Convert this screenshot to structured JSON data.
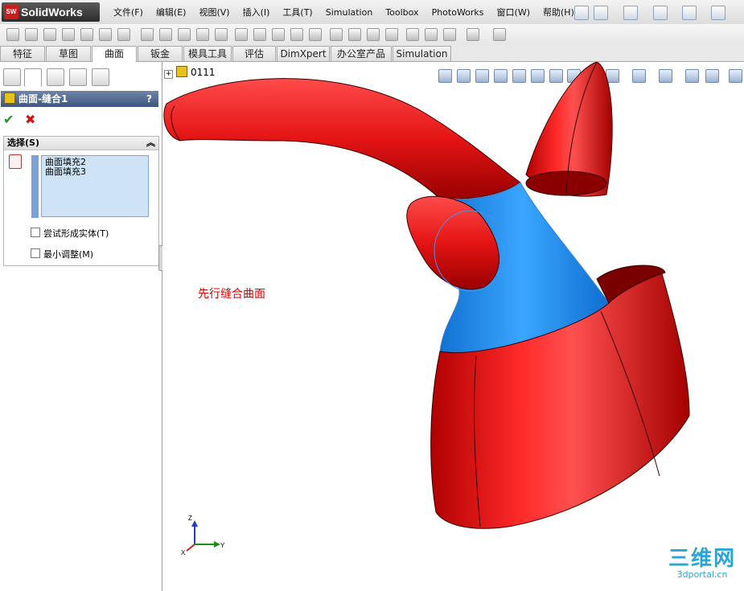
{
  "app": {
    "logo_text": "SolidWorks",
    "logo_badge": "SW"
  },
  "menu": [
    "文件(F)",
    "编辑(E)",
    "视图(V)",
    "插入(I)",
    "工具(T)",
    "Simulation",
    "Toolbox",
    "PhotoWorks",
    "窗口(W)",
    "帮助(H)"
  ],
  "command_tabs": [
    "特征",
    "草图",
    "曲面",
    "钣金",
    "模具工具",
    "评估",
    "DimXpert",
    "办公室产品",
    "Simulation"
  ],
  "active_tab": "曲面",
  "feature": {
    "title": "曲面-缝合1",
    "help": "?",
    "ok_icon": "✔",
    "cancel_icon": "✖",
    "group_title": "选择(S)",
    "collapse_icon": "︽",
    "selections": [
      "曲面填充2",
      "曲面填充3"
    ],
    "options": [
      {
        "label": "尝试形成实体(T)",
        "checked": false
      },
      {
        "label": "最小调整(M)",
        "checked": false
      }
    ]
  },
  "tree": {
    "expand": "+",
    "part_name": "0111"
  },
  "annotation": "先行缝合曲面",
  "triad": {
    "z": "Z",
    "y": "Y",
    "x": "X"
  },
  "watermark": {
    "main": "三维网",
    "sub": "3dportal.cn"
  },
  "colors": {
    "surface_red": "#e41414",
    "surface_blue": "#1b8ce8",
    "header": "#3e5680"
  }
}
